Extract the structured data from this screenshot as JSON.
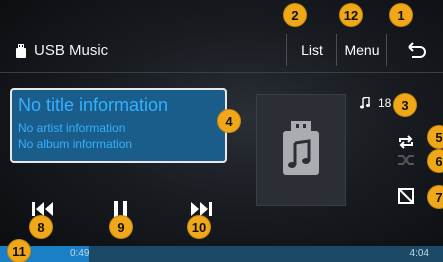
{
  "header": {
    "source_label": "USB Music",
    "list_label": "List",
    "menu_label": "Menu"
  },
  "track": {
    "number": "18",
    "title": "No title information",
    "artist": "No artist information",
    "album": "No album information"
  },
  "progress": {
    "current": "0:49",
    "total": "4:04",
    "fraction": 0.2
  },
  "callouts": {
    "c1": "1",
    "c2": "2",
    "c3": "3",
    "c4": "4",
    "c5": "5",
    "c6": "6",
    "c7": "7",
    "c8": "8",
    "c9": "9",
    "c10": "10",
    "c11": "11",
    "c12": "12"
  },
  "icons": [
    "usb-icon",
    "back-icon",
    "music-note-icon",
    "repeat-icon",
    "shuffle-icon",
    "copy-icon",
    "previous-track-icon",
    "pause-icon",
    "next-track-icon",
    "album-art-icon"
  ],
  "colors": {
    "accent": "#33b0ff",
    "info_bg": "#1b5d8a",
    "callout": "#f0a818",
    "progress_fill": "#1a7fc4"
  }
}
